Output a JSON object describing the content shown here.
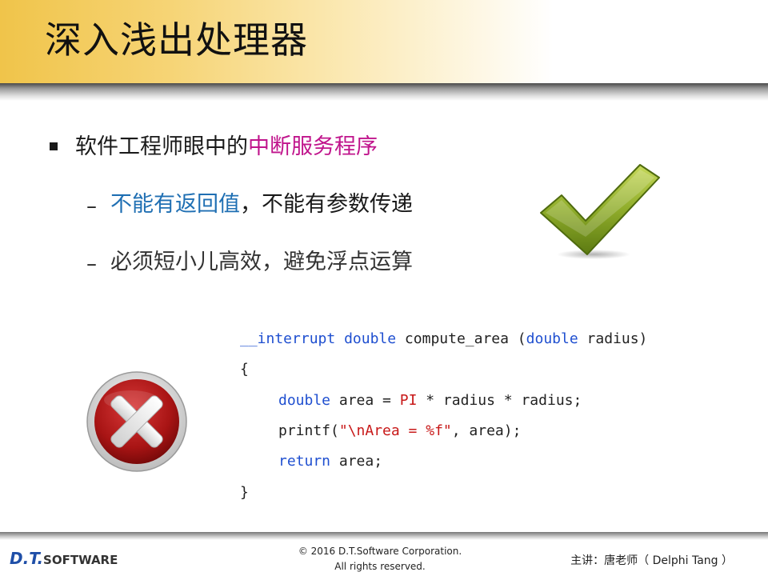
{
  "slide": {
    "title": "深入浅出处理器"
  },
  "bullets": {
    "main_prefix": "软件工程师眼中的",
    "main_highlight": "中断服务程序",
    "sub1_dash": "–",
    "sub1_part_blue": "不能有返回值",
    "sub1_sep": "，",
    "sub1_part_dark": "不能有参数传递",
    "sub2_dash": "–",
    "sub2_text": "必须短小儿高效，避免浮点运算"
  },
  "code": {
    "line1_kw1": "__interrupt",
    "line1_kw2": "double",
    "line1_name": " compute_area (",
    "line1_kw3": "double",
    "line1_rest": " radius)",
    "line2": "{",
    "line3_kw": "double",
    "line3_mid": " area = ",
    "line3_const": "PI",
    "line3_rest": " * radius * radius;",
    "line4_fn": "printf(",
    "line4_str": "\"\\nArea = %f\"",
    "line4_rest": ", area);",
    "line5_kw": "return",
    "line5_rest": " area;",
    "line6": "}"
  },
  "icons": {
    "check": "checkmark-icon",
    "cross": "cross-icon"
  },
  "footer": {
    "logo_dt": "D.T.",
    "logo_software": "SOFTWARE",
    "copyright_line1": "© 2016 D.T.Software Corporation.",
    "copyright_line2": "All rights reserved.",
    "presenter": "主讲：唐老师（ Delphi Tang ）"
  },
  "colors": {
    "title_band": "#f0c44a",
    "highlight_magenta": "#c0148c",
    "highlight_blue": "#1f6fb3",
    "code_keyword": "#1f4fd0",
    "code_string": "#c81919"
  }
}
